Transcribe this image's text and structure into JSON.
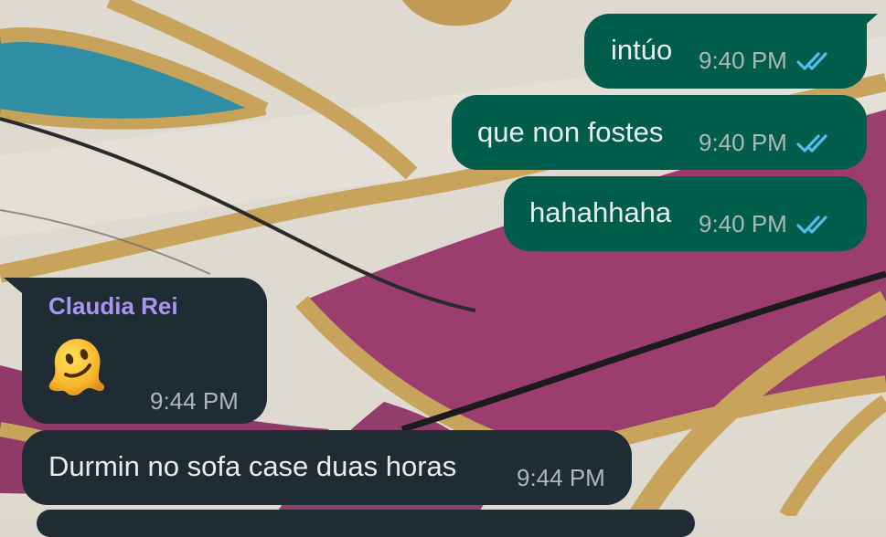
{
  "colors": {
    "outgoing_bubble": "#005c4b",
    "incoming_bubble": "#1f2c34",
    "sender_name": "#a996f1",
    "read_ticks": "#53bdeb"
  },
  "messages": [
    {
      "direction": "outgoing",
      "text": "intúo",
      "time": "9:40 PM",
      "status_icon": "double-check-read-icon"
    },
    {
      "direction": "outgoing",
      "text": "que non fostes",
      "time": "9:40 PM",
      "status_icon": "double-check-read-icon"
    },
    {
      "direction": "outgoing",
      "text": "hahahhaha",
      "time": "9:40 PM",
      "status_icon": "double-check-read-icon"
    },
    {
      "direction": "incoming",
      "sender": "Claudia Rei",
      "emoji_icon": "melting-face-emoji",
      "time": "9:44 PM"
    },
    {
      "direction": "incoming",
      "text": "Durmin no sofa case duas horas",
      "time": "9:44 PM"
    }
  ]
}
